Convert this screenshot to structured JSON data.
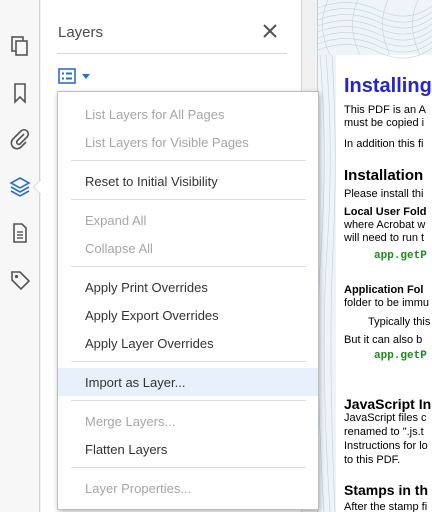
{
  "panel": {
    "title": "Layers",
    "close_icon": "close-icon",
    "options_icon": "layers-options-icon"
  },
  "rail": {
    "items": [
      {
        "name": "page-thumbnails-icon"
      },
      {
        "name": "bookmark-icon"
      },
      {
        "name": "attachment-icon"
      },
      {
        "name": "layers-icon",
        "active": true
      },
      {
        "name": "document-icon"
      },
      {
        "name": "tag-icon"
      }
    ],
    "active_color": "#2d6ec9"
  },
  "menu": {
    "items": [
      {
        "label": "List Layers for All Pages",
        "enabled": false
      },
      {
        "label": "List Layers for Visible Pages",
        "enabled": false
      },
      {
        "label": "Reset to Initial Visibility",
        "enabled": true
      },
      {
        "label": "Expand All",
        "enabled": false
      },
      {
        "label": "Collapse All",
        "enabled": false
      },
      {
        "label": "Apply Print Overrides",
        "enabled": true
      },
      {
        "label": "Apply Export Overrides",
        "enabled": true
      },
      {
        "label": "Apply Layer Overrides",
        "enabled": true
      },
      {
        "label": "Import as Layer...",
        "enabled": true,
        "highlighted": true
      },
      {
        "label": "Merge Layers...",
        "enabled": false
      },
      {
        "label": "Flatten Layers",
        "enabled": true
      },
      {
        "label": "Layer Properties...",
        "enabled": false
      }
    ]
  },
  "document": {
    "heading": "Installing",
    "intro_1": "This PDF is an A",
    "intro_2": "must be copied i",
    "intro_3": "In addition this fi",
    "h_installation": "Installation",
    "please_install": "Please install thi",
    "local_user_folder": "Local User Fold",
    "where_acrobat": "where Acrobat w",
    "will_need": "will need to run t",
    "code_1": "app.getP",
    "app_folder": "Application Fol",
    "folder_immu": "folder to be immu",
    "typically": "Typically this",
    "but_it_can": "But it can also b",
    "code_2": "app.getP",
    "h_javascript": "JavaScript In",
    "js_files": "JavaScript files c",
    "renamed": "renamed to \".js.t",
    "instructions": "Instructions for lo",
    "to_this_pdf": "to this PDF.",
    "h_stamps": "Stamps in th",
    "after_stamp": "After the stamp fi",
    "heading_color": "#2424d0",
    "code_color": "#1c8a1c"
  }
}
